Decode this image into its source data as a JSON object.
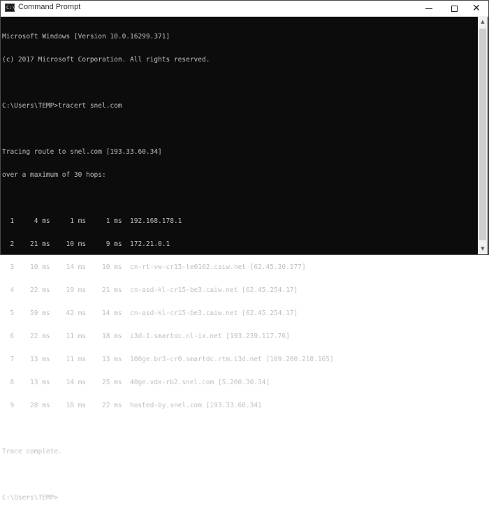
{
  "window": {
    "title": "Command Prompt",
    "icon_label": "C:\\"
  },
  "console": {
    "lines": [
      "Microsoft Windows [Version 10.0.16299.371]",
      "(c) 2017 Microsoft Corporation. All rights reserved.",
      "",
      "C:\\Users\\TEMP>tracert snel.com",
      "",
      "Tracing route to snel.com [193.33.60.34]",
      "over a maximum of 30 hops:",
      "",
      "  1     4 ms     1 ms     1 ms  192.168.178.1",
      "  2    21 ms    10 ms     9 ms  172.21.0.1",
      "  3    10 ms    14 ms    10 ms  cn-rt-vw-cr15-te0102.caiw.net [62.45.30.177]",
      "  4    22 ms    19 ms    21 ms  cn-asd-kl-cr15-be3.caiw.net [62.45.254.17]",
      "  5    59 ms    42 ms    14 ms  cn-asd-kl-cr15-be3.caiw.net [62.45.254.17]",
      "  6    22 ms    11 ms    18 ms  i3d-1.smartdc.nl-ix.net [193.239.117.76]",
      "  7    13 ms    11 ms    13 ms  100ge.br3-cr0.smartdc.rtm.i3d.net [109.200.218.165]",
      "  8    13 ms    14 ms    25 ms  40ge.vdx-rb2.snel.com [5.200.30.34]",
      "  9    28 ms    18 ms    22 ms  hosted-by.snel.com [193.33.60.34]",
      "",
      "Trace complete.",
      "",
      "C:\\Users\\TEMP>"
    ]
  },
  "icons": {
    "minimize": "minimize-icon",
    "maximize": "maximize-icon",
    "close": "close-icon",
    "close_glyph": "✕",
    "scroll_up_glyph": "▲",
    "scroll_down_glyph": "▼"
  },
  "colors": {
    "console_background": "#0c0c0c",
    "console_text": "#c0c0c0",
    "titlebar": "#ffffff"
  }
}
